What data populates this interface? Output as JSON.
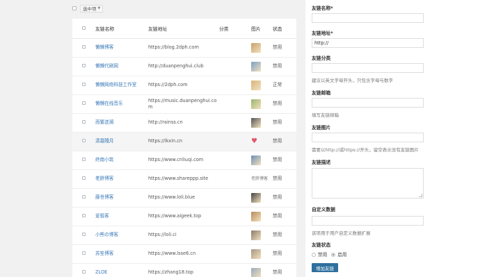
{
  "toolbar": {
    "bulk_label": "选中项"
  },
  "table": {
    "headers": [
      "友链名称",
      "友链地址",
      "分类",
      "图片",
      "状态"
    ],
    "rows": [
      {
        "name": "懒懒博客",
        "url": "https://blog.2dph.com",
        "category": "",
        "image": "thumb",
        "status": "禁用"
      },
      {
        "name": "懒懒代刷网",
        "url": "http://duanpenghui.club",
        "category": "",
        "image": "thumb",
        "status": "禁用"
      },
      {
        "name": "懒懒网络科技工作室",
        "url": "https://2dph.com",
        "category": "",
        "image": "thumb",
        "status": "正常"
      },
      {
        "name": "懒懒在线音乐",
        "url": "https://music.duanpenghui.com",
        "category": "",
        "image": "thumb",
        "status": "禁用"
      },
      {
        "name": "而繁涟漪",
        "url": "http://rainss.cn",
        "category": "",
        "image": "thumb",
        "status": "禁用"
      },
      {
        "name": "清霜殘月",
        "url": "https://lkxin.cn",
        "category": "",
        "image": "heart",
        "status": "禁用"
      },
      {
        "name": "终南小筑",
        "url": "https://www.cnliuqi.com",
        "category": "",
        "image": "thumb",
        "status": "禁用"
      },
      {
        "name": "老胖博客",
        "url": "https://www.shareppp.site",
        "category": "",
        "image": "broken",
        "image_alt": "老胖博客",
        "status": "禁用"
      },
      {
        "name": "藤世博客",
        "url": "https://www.loli.blue",
        "category": "",
        "image": "thumb",
        "status": "禁用"
      },
      {
        "name": "爱极客",
        "url": "https://www.aigeek.top",
        "category": "",
        "image": "thumb",
        "status": "禁用"
      },
      {
        "name": "小熊の博客",
        "url": "https://loli.ci",
        "category": "",
        "image": "thumb",
        "status": "禁用"
      },
      {
        "name": "苏笙博客",
        "url": "https://www.lsse6.cn",
        "category": "",
        "image": "thumb",
        "status": "禁用"
      },
      {
        "name": "ZLOE",
        "url": "https://zhang18.top",
        "category": "",
        "image": "thumb",
        "status": "禁用"
      }
    ]
  },
  "form": {
    "name_label": "友链名称*",
    "name_value": "",
    "url_label": "友链地址*",
    "url_value": "http://",
    "category_label": "友链分类",
    "category_help": "建议以英文字母开头，只包含字母与数字",
    "email_label": "友链邮箱",
    "email_help": "填写友链邮箱",
    "image_label": "友链图片",
    "image_help": "需要以http://或https://开头，留空表示没有友链图片",
    "desc_label": "友链描述",
    "custom_label": "自定义数据",
    "custom_help": "该项用于用户自定义数据扩展",
    "status_label": "友链状态",
    "status_options": [
      "禁用",
      "启用"
    ],
    "status_selected": "启用",
    "submit_label": "增加友链"
  }
}
